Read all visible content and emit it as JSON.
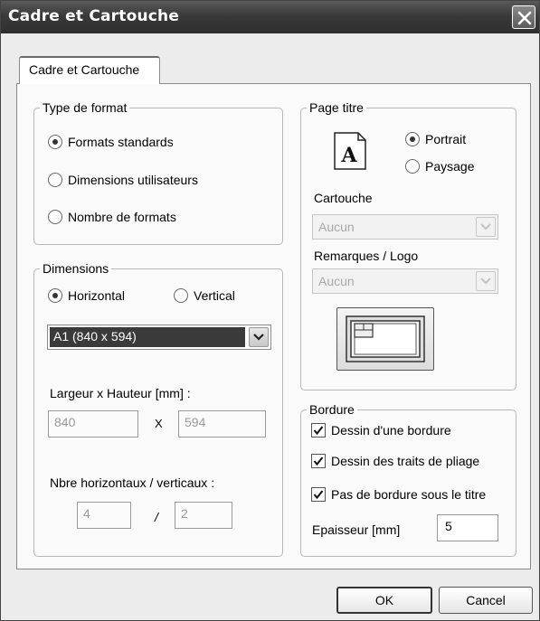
{
  "window": {
    "title": "Cadre et Cartouche"
  },
  "tab": {
    "label": "Cadre et Cartouche"
  },
  "type_format": {
    "legend": "Type de format",
    "options": [
      {
        "label": "Formats standards",
        "selected": true
      },
      {
        "label": "Dimensions utilisateurs",
        "selected": false
      },
      {
        "label": "Nombre de formats",
        "selected": false
      }
    ]
  },
  "dimensions": {
    "legend": "Dimensions",
    "orientation": [
      {
        "label": "Horizontal",
        "selected": true
      },
      {
        "label": "Vertical",
        "selected": false
      }
    ],
    "format_select": "A1 (840 x 594)",
    "size_label": "Largeur x Hauteur [mm] :",
    "width": "840",
    "height": "594",
    "size_separator": "X",
    "count_label": "Nbre horizontaux / verticaux :",
    "count_h": "4",
    "count_v": "2",
    "count_separator": "/"
  },
  "page_titre": {
    "legend": "Page titre",
    "icon_letter": "A",
    "orientation": [
      {
        "label": "Portrait",
        "selected": true
      },
      {
        "label": "Paysage",
        "selected": false
      }
    ],
    "cartouche_label": "Cartouche",
    "cartouche_value": "Aucun",
    "remarques_label": "Remarques / Logo",
    "remarques_value": "Aucun"
  },
  "bordure": {
    "legend": "Bordure",
    "checks": [
      {
        "label": "Dessin d'une bordure",
        "checked": true
      },
      {
        "label": "Dessin des traits de pliage",
        "checked": true
      },
      {
        "label": "Pas de bordure sous le titre",
        "checked": true
      }
    ],
    "epaisseur_label": "Epaisseur [mm]",
    "epaisseur_value": "5"
  },
  "buttons": {
    "ok": "OK",
    "cancel": "Cancel"
  },
  "icons": [
    "close-icon",
    "dropdown-arrow-icon",
    "page-a-icon",
    "title-block-preview-icon",
    "checkmark-icon"
  ]
}
